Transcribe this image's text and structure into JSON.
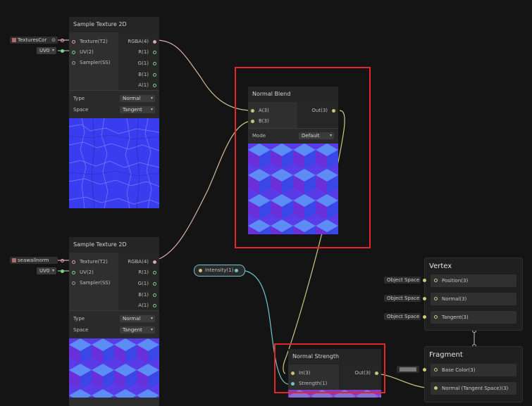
{
  "colors": {
    "canvas": "#141414",
    "wire_pink": "#e0a6b8",
    "wire_yellow": "#cfc782",
    "wire_teal": "#6ec6cc",
    "highlight": "#e3262a",
    "normal_map_blue": "#3a3cf0"
  },
  "texture_node_1": {
    "title": "Sample Texture 2D",
    "input_field": "TexturesCor",
    "uv_field": "UV0",
    "inputs": [
      "Texture(T2)",
      "UV(2)",
      "Sampler(SS)"
    ],
    "outputs": [
      "RGBA(4)",
      "R(1)",
      "G(1)",
      "B(1)",
      "A(1)"
    ],
    "type_label": "Type",
    "type_value": "Normal",
    "space_label": "Space",
    "space_value": "Tangent"
  },
  "texture_node_2": {
    "title": "Sample Texture 2D",
    "input_field": "seawallnorm",
    "uv_field": "UV0",
    "inputs": [
      "Texture(T2)",
      "UV(2)",
      "Sampler(SS)"
    ],
    "outputs": [
      "RGBA(4)",
      "R(1)",
      "G(1)",
      "B(1)",
      "A(1)"
    ],
    "type_label": "Type",
    "type_value": "Normal",
    "space_label": "Space",
    "space_value": "Tangent"
  },
  "normal_blend": {
    "title": "Normal Blend",
    "inputs": [
      "A(3)",
      "B(3)"
    ],
    "output": "Out(3)",
    "mode_label": "Mode",
    "mode_value": "Default"
  },
  "property": {
    "label": "Intensity(1)"
  },
  "normal_strength": {
    "title": "Normal Strength",
    "inputs": [
      "In(3)",
      "Strength(1)"
    ],
    "output": "Out(3)"
  },
  "vertex": {
    "title": "Vertex",
    "slots": [
      {
        "space": "Object Space",
        "label": "Position(3)"
      },
      {
        "space": "Object Space",
        "label": "Normal(3)"
      },
      {
        "space": "Object Space",
        "label": "Tangent(3)"
      }
    ]
  },
  "fragment": {
    "title": "Fragment",
    "slots": [
      {
        "label": "Base Color(3)"
      },
      {
        "label": "Normal (Tangent Space)(3)"
      }
    ]
  }
}
